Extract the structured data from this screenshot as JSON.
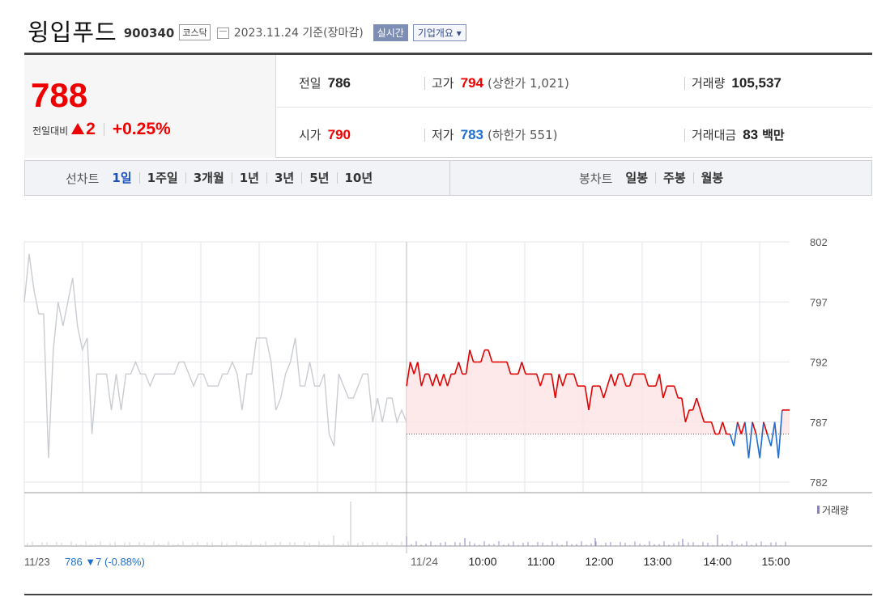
{
  "header": {
    "company_name": "윙입푸드",
    "stock_code": "900340",
    "market": "코스닥",
    "date_text": "2023.11.24  기준(장마감)",
    "realtime_label": "실시간",
    "overview_label": "기업개요",
    "overview_arrow": "▾"
  },
  "price": {
    "current": "788",
    "change_label": "전일대비",
    "change_value": "2",
    "change_pct": "+0.25%"
  },
  "stats": {
    "prev_close_label": "전일",
    "prev_close": "786",
    "high_label": "고가",
    "high": "794",
    "upper_limit": "(상한가 1,021)",
    "volume_label": "거래량",
    "volume": "105,537",
    "open_label": "시가",
    "open": "790",
    "low_label": "저가",
    "low": "783",
    "lower_limit": "(하한가 551)",
    "amount_label": "거래대금",
    "amount": "83",
    "amount_unit": "백만"
  },
  "period_bar": {
    "line_chart_label": "선차트",
    "line_periods": [
      "1일",
      "1주일",
      "3개월",
      "1년",
      "3년",
      "5년",
      "10년"
    ],
    "active_period": 0,
    "candle_chart_label": "봉차트",
    "candle_periods": [
      "일봉",
      "주봉",
      "월봉"
    ]
  },
  "colors": {
    "up": "#e00000",
    "down": "#1f6fd1",
    "prev_day_line": "#c9ccd1",
    "fill_up": "#fde3e3",
    "accent": "#1f4fbf"
  },
  "chart_data": {
    "type": "line",
    "y_ticks": [
      "802",
      "797",
      "792",
      "787",
      "782"
    ],
    "ylim": [
      782,
      802
    ],
    "base_price": 786,
    "x_ticks": [
      "11/24",
      "10:00",
      "11:00",
      "12:00",
      "13:00",
      "14:00",
      "15:00"
    ],
    "prev_day_label": "11/23",
    "prev_day_summary": "786 ▼7 (-0.88%)",
    "volume_legend": "거래량",
    "grid": true,
    "prev_day_series": [
      797,
      801,
      798,
      796,
      796,
      784,
      793,
      797,
      795,
      797,
      799,
      795,
      793,
      794,
      786,
      791,
      791,
      791,
      788,
      791,
      788,
      791,
      791,
      792,
      791,
      791,
      790,
      791,
      791,
      791,
      791,
      791,
      792,
      792,
      791,
      790,
      791,
      791,
      790,
      790,
      790,
      791,
      791,
      792,
      791,
      788,
      791,
      791,
      794,
      794,
      794,
      792,
      788,
      789,
      791,
      792,
      794,
      790,
      790,
      792,
      790,
      790,
      791,
      786,
      785,
      791,
      790,
      789,
      789,
      790,
      791,
      791,
      787,
      789,
      787,
      789,
      789,
      787,
      788,
      787
    ],
    "today_series": [
      790,
      792,
      791,
      792,
      790,
      791,
      791,
      790,
      791,
      790,
      791,
      790,
      791,
      791,
      792,
      791,
      791,
      793,
      792,
      792,
      792,
      793,
      793,
      792,
      792,
      792,
      792,
      792,
      791,
      791,
      791,
      792,
      791,
      791,
      791,
      791,
      790,
      791,
      791,
      791,
      789,
      791,
      790,
      791,
      791,
      791,
      790,
      790,
      790,
      788,
      790,
      790,
      790,
      789,
      790,
      791,
      790,
      791,
      791,
      790,
      790,
      791,
      791,
      791,
      791,
      790,
      790,
      790,
      791,
      789,
      790,
      790,
      790,
      789,
      789,
      787,
      788,
      788,
      789,
      788,
      787,
      787,
      787,
      786,
      786,
      787,
      786,
      786,
      785,
      787,
      786,
      787,
      784,
      787,
      786,
      784,
      787,
      786,
      785,
      787,
      784,
      788,
      788,
      788
    ]
  }
}
